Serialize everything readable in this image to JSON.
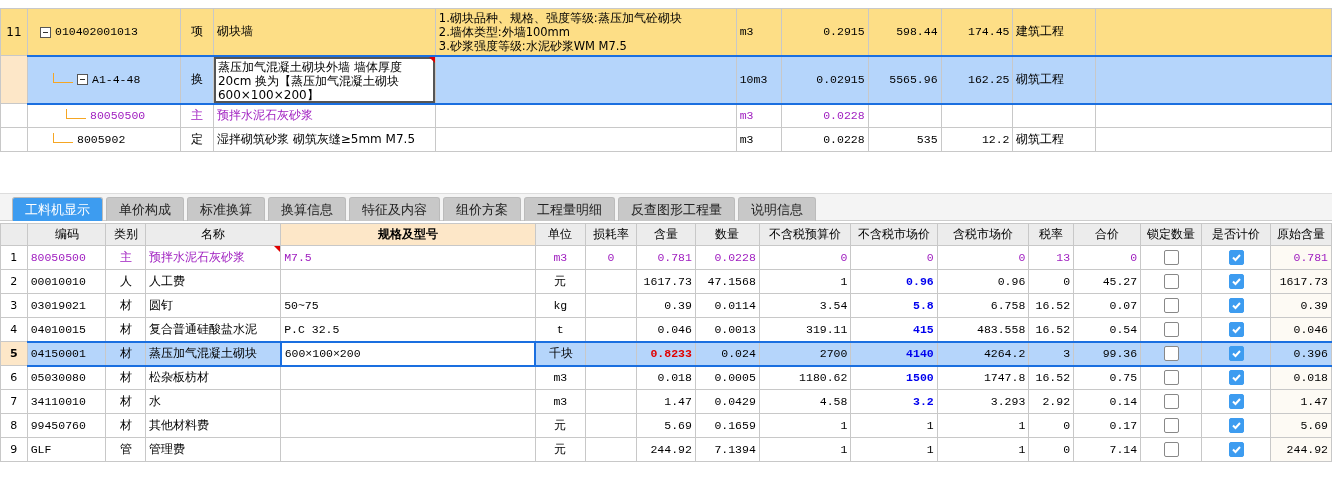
{
  "top_table": {
    "rows": [
      {
        "no": "11",
        "code": "010402001013",
        "type": "项",
        "name": "砌块墙",
        "features": [
          "1.砌块品种、规格、强度等级:蒸压加气砼砌块",
          "2.墙体类型:外墙100mm",
          "3.砂浆强度等级:水泥砂浆WM M7.5"
        ],
        "unit": "m3",
        "qty": "0.2915",
        "price": "598.44",
        "total": "174.45",
        "category": "建筑工程",
        "kind": "item",
        "selected": false,
        "expanded": true,
        "note": false,
        "children": [
          {
            "code": "A1-4-48",
            "type": "换",
            "name": "蒸压加气混凝土砌块外墙 墙体厚度 20cm 换为【蒸压加气混凝土砌块 600×100×200】",
            "unit": "10m3",
            "qty": "0.02915",
            "price": "5565.96",
            "total": "162.25",
            "category": "砌筑工程",
            "kind": "quota",
            "selected": true,
            "expanded": true,
            "note": true,
            "children": [
              {
                "code": "80050500",
                "type": "主",
                "name": "预拌水泥石灰砂浆",
                "unit": "m3",
                "qty": "0.0228",
                "kind": "main",
                "selected": false,
                "note": false
              }
            ]
          },
          {
            "code": "8005902",
            "type": "定",
            "name": "湿拌砌筑砂浆 砌筑灰缝≥5mm M7.5",
            "unit": "m3",
            "qty": "0.0228",
            "price": "535",
            "total": "12.2",
            "category": "砌筑工程",
            "kind": "quota",
            "selected": false,
            "note": false
          }
        ]
      }
    ]
  },
  "tabs": [
    {
      "label": "工料机显示",
      "selected": true
    },
    {
      "label": "单价构成",
      "selected": false
    },
    {
      "label": "标准换算",
      "selected": false
    },
    {
      "label": "换算信息",
      "selected": false
    },
    {
      "label": "特征及内容",
      "selected": false
    },
    {
      "label": "组价方案",
      "selected": false
    },
    {
      "label": "工程量明细",
      "selected": false
    },
    {
      "label": "反查图形工程量",
      "selected": false
    },
    {
      "label": "说明信息",
      "selected": false
    }
  ],
  "materials": {
    "columns": [
      "编码",
      "类别",
      "名称",
      "规格及型号",
      "单位",
      "损耗率",
      "含量",
      "数量",
      "不含税预算价",
      "不含税市场价",
      "含税市场价",
      "税率",
      "合价",
      "锁定数量",
      "是否计价",
      "原始含量"
    ],
    "rows": [
      {
        "no": "1",
        "code": "80050500",
        "type": "主",
        "name": "预拌水泥石灰砂浆",
        "spec": "M7.5",
        "unit": "m3",
        "loss": "0",
        "content": "0.781",
        "qty": "0.0228",
        "budget": "0",
        "market": "0",
        "tax_market": "0",
        "rate": "13",
        "total": "0",
        "locked": false,
        "priced": true,
        "original": "0.781",
        "kind": "main",
        "selected": false,
        "note": true,
        "market_edited": false,
        "content_changed": false
      },
      {
        "no": "2",
        "code": "00010010",
        "type": "人",
        "name": "人工费",
        "unit": "元",
        "content": "1617.73",
        "qty": "47.1568",
        "budget": "1",
        "market": "0.96",
        "tax_market": "0.96",
        "rate": "0",
        "total": "45.27",
        "locked": false,
        "priced": true,
        "original": "1617.73",
        "kind": "normal",
        "selected": false,
        "note": false,
        "market_edited": true,
        "content_changed": false
      },
      {
        "no": "3",
        "code": "03019021",
        "type": "材",
        "name": "圆钉",
        "spec": "50~75",
        "unit": "kg",
        "content": "0.39",
        "qty": "0.0114",
        "budget": "3.54",
        "market": "5.8",
        "tax_market": "6.758",
        "rate": "16.52",
        "total": "0.07",
        "locked": false,
        "priced": true,
        "original": "0.39",
        "kind": "normal",
        "selected": false,
        "note": false,
        "market_edited": true,
        "content_changed": false
      },
      {
        "no": "4",
        "code": "04010015",
        "type": "材",
        "name": "复合普通硅酸盐水泥",
        "spec": "P.C 32.5",
        "unit": "t",
        "content": "0.046",
        "qty": "0.0013",
        "budget": "319.11",
        "market": "415",
        "tax_market": "483.558",
        "rate": "16.52",
        "total": "0.54",
        "locked": false,
        "priced": true,
        "original": "0.046",
        "kind": "normal",
        "selected": false,
        "note": false,
        "market_edited": true,
        "content_changed": false
      },
      {
        "no": "5",
        "code": "04150001",
        "type": "材",
        "name": "蒸压加气混凝土砌块",
        "spec": "600×100×200",
        "unit": "千块",
        "content": "0.8233",
        "qty": "0.024",
        "budget": "2700",
        "market": "4140",
        "tax_market": "4264.2",
        "rate": "3",
        "total": "99.36",
        "locked": false,
        "priced": true,
        "original": "0.396",
        "kind": "normal",
        "selected": true,
        "note": false,
        "market_edited": true,
        "content_changed": true
      },
      {
        "no": "6",
        "code": "05030080",
        "type": "材",
        "name": "松杂板枋材",
        "unit": "m3",
        "content": "0.018",
        "qty": "0.0005",
        "budget": "1180.62",
        "market": "1500",
        "tax_market": "1747.8",
        "rate": "16.52",
        "total": "0.75",
        "locked": false,
        "priced": true,
        "original": "0.018",
        "kind": "normal",
        "selected": false,
        "note": false,
        "market_edited": true,
        "content_changed": false
      },
      {
        "no": "7",
        "code": "34110010",
        "type": "材",
        "name": "水",
        "unit": "m3",
        "content": "1.47",
        "qty": "0.0429",
        "budget": "4.58",
        "market": "3.2",
        "tax_market": "3.293",
        "rate": "2.92",
        "total": "0.14",
        "locked": false,
        "priced": true,
        "original": "1.47",
        "kind": "normal",
        "selected": false,
        "note": false,
        "market_edited": true,
        "content_changed": false
      },
      {
        "no": "8",
        "code": "99450760",
        "type": "材",
        "name": "其他材料费",
        "unit": "元",
        "content": "5.69",
        "qty": "0.1659",
        "budget": "1",
        "market": "1",
        "tax_market": "1",
        "rate": "0",
        "total": "0.17",
        "locked": false,
        "priced": true,
        "original": "5.69",
        "kind": "normal",
        "selected": false,
        "note": false,
        "market_edited": false,
        "content_changed": false
      },
      {
        "no": "9",
        "code": "GLF",
        "type": "管",
        "name": "管理费",
        "unit": "元",
        "content": "244.92",
        "qty": "7.1394",
        "budget": "1",
        "market": "1",
        "tax_market": "1",
        "rate": "0",
        "total": "7.14",
        "locked": false,
        "priced": true,
        "original": "244.92",
        "kind": "normal",
        "selected": false,
        "note": false,
        "market_edited": false,
        "content_changed": false
      }
    ]
  }
}
